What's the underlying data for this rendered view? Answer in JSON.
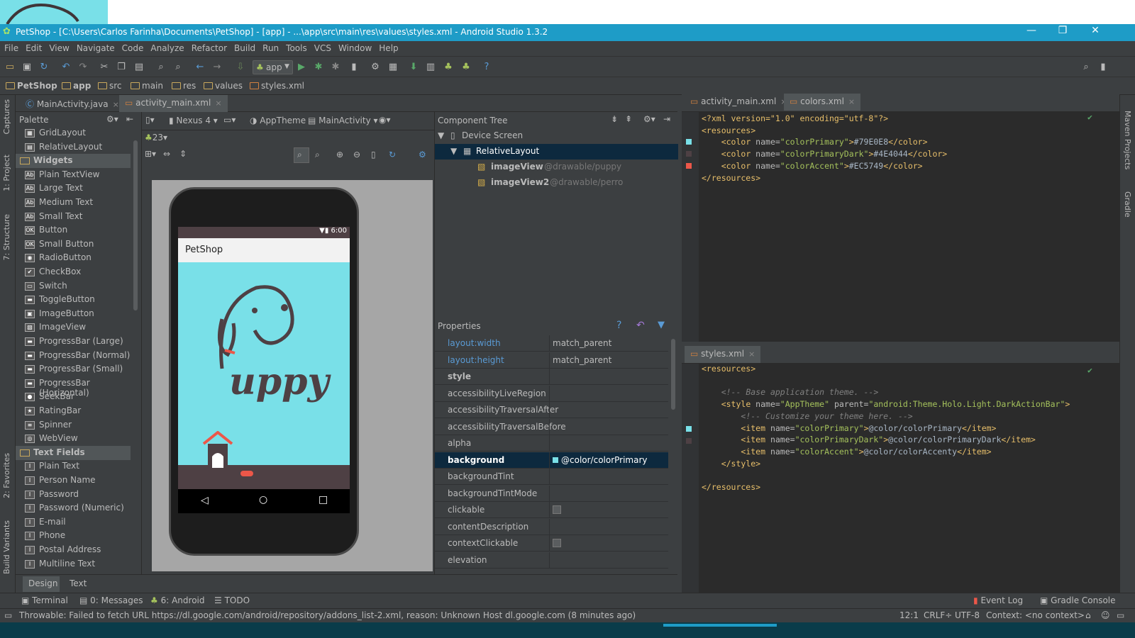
{
  "window": {
    "title": "PetShop - [C:\\Users\\Carlos Farinha\\Documents\\PetShop] - [app] - ...\\app\\src\\main\\res\\values\\styles.xml - Android Studio 1.3.2",
    "minimize": "—",
    "maximize": "❐",
    "close": "✕"
  },
  "menu": [
    "File",
    "Edit",
    "View",
    "Navigate",
    "Code",
    "Analyze",
    "Refactor",
    "Build",
    "Run",
    "Tools",
    "VCS",
    "Window",
    "Help"
  ],
  "toolbar": {
    "run_config": "app",
    "help": "?"
  },
  "breadcrumb": [
    "PetShop",
    "app",
    "src",
    "main",
    "res",
    "values",
    "styles.xml"
  ],
  "left_tools": {
    "captures": "Captures",
    "project": "1: Project",
    "structure": "7: Structure",
    "favorites": "2: Favorites",
    "build_variants": "Build Variants"
  },
  "right_tools": {
    "maven": "Maven Projects",
    "gradle": "Gradle"
  },
  "left_tabs": [
    {
      "label": "MainActivity.java",
      "close": "×"
    },
    {
      "label": "activity_main.xml",
      "close": "×"
    }
  ],
  "right_tabs_top": [
    {
      "label": "activity_main.xml",
      "close": "×"
    },
    {
      "label": "colors.xml",
      "close": "×"
    }
  ],
  "right_tabs_bottom": [
    {
      "label": "styles.xml",
      "close": "×"
    }
  ],
  "palette": {
    "title": "Palette",
    "items": [
      {
        "type": "item",
        "label": "GridLayout",
        "icon": "grid-layout-icon",
        "glyph": "▦"
      },
      {
        "type": "item",
        "label": "RelativeLayout",
        "icon": "relative-layout-icon",
        "glyph": "▤"
      },
      {
        "type": "group",
        "label": "Widgets"
      },
      {
        "type": "item",
        "label": "Plain TextView",
        "icon": "textview-icon",
        "glyph": "Ab"
      },
      {
        "type": "item",
        "label": "Large Text",
        "icon": "textview-icon",
        "glyph": "Ab"
      },
      {
        "type": "item",
        "label": "Medium Text",
        "icon": "textview-icon",
        "glyph": "Ab"
      },
      {
        "type": "item",
        "label": "Small Text",
        "icon": "textview-icon",
        "glyph": "Ab"
      },
      {
        "type": "item",
        "label": "Button",
        "icon": "button-icon",
        "glyph": "OK"
      },
      {
        "type": "item",
        "label": "Small Button",
        "icon": "button-icon",
        "glyph": "OK"
      },
      {
        "type": "item",
        "label": "RadioButton",
        "icon": "radio-icon",
        "glyph": "◉"
      },
      {
        "type": "item",
        "label": "CheckBox",
        "icon": "checkbox-icon",
        "glyph": "✔"
      },
      {
        "type": "item",
        "label": "Switch",
        "icon": "switch-icon",
        "glyph": "▭"
      },
      {
        "type": "item",
        "label": "ToggleButton",
        "icon": "toggle-icon",
        "glyph": "▬"
      },
      {
        "type": "item",
        "label": "ImageButton",
        "icon": "image-button-icon",
        "glyph": "▣"
      },
      {
        "type": "item",
        "label": "ImageView",
        "icon": "image-view-icon",
        "glyph": "▧"
      },
      {
        "type": "item",
        "label": "ProgressBar (Large)",
        "icon": "progressbar-icon",
        "glyph": "▬"
      },
      {
        "type": "item",
        "label": "ProgressBar (Normal)",
        "icon": "progressbar-icon",
        "glyph": "▬"
      },
      {
        "type": "item",
        "label": "ProgressBar (Small)",
        "icon": "progressbar-icon",
        "glyph": "▬"
      },
      {
        "type": "item",
        "label": "ProgressBar (Horizontal)",
        "icon": "progressbar-icon",
        "glyph": "▬"
      },
      {
        "type": "item",
        "label": "SeekBar",
        "icon": "seekbar-icon",
        "glyph": "●"
      },
      {
        "type": "item",
        "label": "RatingBar",
        "icon": "star-icon",
        "glyph": "★"
      },
      {
        "type": "item",
        "label": "Spinner",
        "icon": "spinner-icon",
        "glyph": "≡"
      },
      {
        "type": "item",
        "label": "WebView",
        "icon": "webview-icon",
        "glyph": "◎"
      },
      {
        "type": "group",
        "label": "Text Fields"
      },
      {
        "type": "item",
        "label": "Plain Text",
        "icon": "text-field-icon",
        "glyph": "I"
      },
      {
        "type": "item",
        "label": "Person Name",
        "icon": "text-field-icon",
        "glyph": "I"
      },
      {
        "type": "item",
        "label": "Password",
        "icon": "text-field-icon",
        "glyph": "I"
      },
      {
        "type": "item",
        "label": "Password (Numeric)",
        "icon": "text-field-icon",
        "glyph": "I"
      },
      {
        "type": "item",
        "label": "E-mail",
        "icon": "text-field-icon",
        "glyph": "I"
      },
      {
        "type": "item",
        "label": "Phone",
        "icon": "text-field-icon",
        "glyph": "I"
      },
      {
        "type": "item",
        "label": "Postal Address",
        "icon": "text-field-icon",
        "glyph": "I"
      },
      {
        "type": "item",
        "label": "Multiline Text",
        "icon": "text-field-icon",
        "glyph": "I"
      }
    ]
  },
  "design_toolbar": {
    "device": "Nexus 4",
    "theme": "AppTheme",
    "activity": "MainActivity",
    "api": "23"
  },
  "phone": {
    "time": "6:00",
    "app_title": "PetShop",
    "brand_text": "uppy",
    "primary": "#79E0E8",
    "dark": "#4E4044",
    "accent": "#EC5749"
  },
  "component_tree": {
    "title": "Component Tree",
    "nodes": [
      {
        "label": "Device Screen",
        "sub": ""
      },
      {
        "label": "RelativeLayout",
        "sub": ""
      },
      {
        "label": "imageView",
        "sub": " - @drawable/puppy"
      },
      {
        "label": "imageView2",
        "sub": " - @drawable/perro"
      }
    ]
  },
  "properties": {
    "title": "Properties",
    "rows": [
      {
        "key": "layout:width",
        "value": "match_parent"
      },
      {
        "key": "layout:height",
        "value": "match_parent"
      },
      {
        "key": "style",
        "value": ""
      },
      {
        "key": "accessibilityLiveRegion",
        "value": ""
      },
      {
        "key": "accessibilityTraversalAfter",
        "value": ""
      },
      {
        "key": "accessibilityTraversalBefore",
        "value": ""
      },
      {
        "key": "alpha",
        "value": ""
      },
      {
        "key": "background",
        "value": "@color/colorPrimary"
      },
      {
        "key": "backgroundTint",
        "value": ""
      },
      {
        "key": "backgroundTintMode",
        "value": ""
      },
      {
        "key": "clickable",
        "value": ""
      },
      {
        "key": "contentDescription",
        "value": ""
      },
      {
        "key": "contextClickable",
        "value": ""
      },
      {
        "key": "elevation",
        "value": ""
      }
    ]
  },
  "colors_xml": {
    "lines": [
      {
        "parts": [
          [
            "pi",
            "<?xml version=\"1.0\" encoding=\"utf-8\"?>"
          ]
        ]
      },
      {
        "parts": [
          [
            "tg",
            "<resources>"
          ]
        ]
      },
      {
        "parts": [
          [
            "tx",
            "    "
          ],
          [
            "tg",
            "<color "
          ],
          [
            "at",
            "name="
          ],
          [
            "av",
            "\"colorPrimary\""
          ],
          [
            "tg",
            ">"
          ],
          [
            "tx",
            "#79E0E8"
          ],
          [
            "tg",
            "</color>"
          ]
        ]
      },
      {
        "parts": [
          [
            "tx",
            "    "
          ],
          [
            "tg",
            "<color "
          ],
          [
            "at",
            "name="
          ],
          [
            "av",
            "\"colorPrimaryDark\""
          ],
          [
            "tg",
            ">"
          ],
          [
            "tx",
            "#4E4044"
          ],
          [
            "tg",
            "</color>"
          ]
        ]
      },
      {
        "parts": [
          [
            "tx",
            "    "
          ],
          [
            "tg",
            "<color "
          ],
          [
            "at",
            "name="
          ],
          [
            "av",
            "\"colorAccent\""
          ],
          [
            "tg",
            ">"
          ],
          [
            "tx",
            "#EC5749"
          ],
          [
            "tg",
            "</color>"
          ]
        ]
      },
      {
        "parts": [
          [
            "tg",
            "</resources>"
          ]
        ]
      }
    ]
  },
  "styles_xml": {
    "lines": [
      {
        "parts": [
          [
            "tg",
            "<resources>"
          ]
        ]
      },
      {
        "parts": [
          [
            "tx",
            ""
          ]
        ]
      },
      {
        "parts": [
          [
            "tx",
            "    "
          ],
          [
            "cm",
            "<!-- Base application theme. -->"
          ]
        ]
      },
      {
        "parts": [
          [
            "tx",
            "    "
          ],
          [
            "tg",
            "<style "
          ],
          [
            "at",
            "name="
          ],
          [
            "av",
            "\"AppTheme\" "
          ],
          [
            "at",
            "parent="
          ],
          [
            "av",
            "\"android:Theme.Holo.Light.DarkActionBar\""
          ],
          [
            "tg",
            ">"
          ]
        ]
      },
      {
        "parts": [
          [
            "tx",
            "        "
          ],
          [
            "cm",
            "<!-- Customize your theme here. -->"
          ]
        ]
      },
      {
        "parts": [
          [
            "tx",
            "        "
          ],
          [
            "tg",
            "<item "
          ],
          [
            "at",
            "name="
          ],
          [
            "av",
            "\"colorPrimary\""
          ],
          [
            "tg",
            ">"
          ],
          [
            "tx",
            "@color/colorPrimary"
          ],
          [
            "tg",
            "</item>"
          ]
        ]
      },
      {
        "parts": [
          [
            "tx",
            "        "
          ],
          [
            "tg",
            "<item "
          ],
          [
            "at",
            "name="
          ],
          [
            "av",
            "\"colorPrimaryDark\""
          ],
          [
            "tg",
            ">"
          ],
          [
            "tx",
            "@color/colorPrimaryDark"
          ],
          [
            "tg",
            "</item>"
          ]
        ]
      },
      {
        "parts": [
          [
            "tx",
            "        "
          ],
          [
            "tg",
            "<item "
          ],
          [
            "at",
            "name="
          ],
          [
            "av",
            "\"colorAccent\""
          ],
          [
            "tg",
            ">"
          ],
          [
            "tx",
            "@color/colorAccenty"
          ],
          [
            "tg",
            "</item>"
          ]
        ]
      },
      {
        "parts": [
          [
            "tx",
            "    "
          ],
          [
            "tg",
            "</style>"
          ]
        ]
      },
      {
        "parts": [
          [
            "tx",
            ""
          ]
        ]
      },
      {
        "parts": [
          [
            "tg",
            "</resources>"
          ]
        ]
      }
    ]
  },
  "design_tabs": {
    "design": "Design",
    "text": "Text"
  },
  "tool_windows": {
    "terminal": "Terminal",
    "messages": "0: Messages",
    "android": "6: Android",
    "todo": "TODO",
    "event_log": "Event Log",
    "gradle_console": "Gradle Console"
  },
  "status": {
    "message": "Throwable: Failed to fetch URL https://dl.google.com/android/repository/addons_list-2.xml, reason: Unknown Host dl.google.com (8 minutes ago)",
    "position": "12:1",
    "line_sep": "CRLF÷",
    "encoding": "UTF-8",
    "context": "Context: <no context>"
  }
}
